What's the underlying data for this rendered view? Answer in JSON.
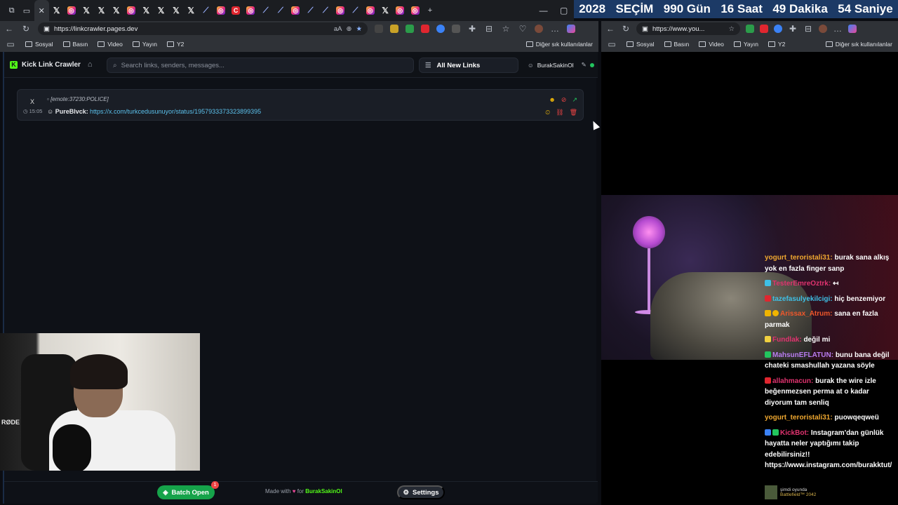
{
  "countdown": {
    "year": "2028",
    "label": "SEÇİM",
    "days": "990 Gün",
    "hours": "16 Saat",
    "minutes": "49 Dakika",
    "seconds": "54 Saniye"
  },
  "browser_left": {
    "url": "https://linkcrawler.pages.dev",
    "tabs": [
      "x",
      "ig",
      "x",
      "x",
      "x",
      "ig",
      "x",
      "x",
      "x",
      "x",
      "feather",
      "ig",
      "red",
      "ig",
      "feather",
      "feather",
      "ig",
      "feather",
      "feather",
      "ig",
      "feather",
      "ig",
      "x",
      "ig",
      "ig"
    ],
    "bookmarks": [
      "Sosyal",
      "Basın",
      "Video",
      "Yayın",
      "Y2"
    ],
    "other_bookmarks": "Diğer sık kullanılanlar"
  },
  "browser_right": {
    "url": "https://www.you...",
    "bookmarks": [
      "Sosyal",
      "Basın",
      "Video",
      "Yayın",
      "Y2"
    ],
    "other_bookmarks": "Diğer sık kullanılanlar"
  },
  "app": {
    "brand": "Kick Link Crawler",
    "search_placeholder": "Search links, senders, messages...",
    "filter_label": "All New Links",
    "username": "BurakSakinOl",
    "message": {
      "platform_icon": "X",
      "time": "15:05",
      "emote": "[emote:37230:POLICE]",
      "sender": "PureBlvck:",
      "link": "https://x.com/turkcedusunuyor/status/1957933373323899395"
    },
    "footer": {
      "batch_label": "Batch Open",
      "batch_count": "1",
      "made_with": "Made with",
      "for": "for",
      "author": "BurakSakinOl",
      "settings_label": "Settings"
    }
  },
  "webcam": {
    "mic_brand": "RØDE"
  },
  "chat": [
    {
      "user": "yogurt_teroristali31:",
      "color": "#f0a830",
      "text": "burak sana alkış yok en fazla finger sanp"
    },
    {
      "user": "TesterEmreOztrk:",
      "color": "#e0336f",
      "text": "↤"
    },
    {
      "user": "tazefasulyekilcigi:",
      "color": "#3ec0e6",
      "text": "hiç benzemiyor"
    },
    {
      "user": "Arissax_Atrum:",
      "color": "#f0572a",
      "text": "sana en fazla parmak"
    },
    {
      "user": "Fundlak:",
      "color": "#e0336f",
      "text": "değil mi"
    },
    {
      "user": "MahsunEFLATUN:",
      "color": "#b87cf0",
      "text": "bunu bana değil chateki smashullah yazana söyle"
    },
    {
      "user": "allahmacun:",
      "color": "#e0336f",
      "text": "burak the wire izle beğenmezsen perma at o kadar diyorum tam senliq"
    },
    {
      "user": "yogurt_teroristali31:",
      "color": "#f0a830",
      "text": "puowqeqweü"
    },
    {
      "user": "KickBot:",
      "color": "#e0336f",
      "text": "Instagram'dan günlük hayatta neler yaptığımı takip edebilirsiniz!! https://www.instagram.com/burakktut/"
    }
  ],
  "now_playing": {
    "label": "şimdi oyunda",
    "game": "Battlefield™ 2042"
  },
  "colors": {
    "kick_green": "#53fc18",
    "batch_green": "#16a34a",
    "link_blue": "#5bc0eb",
    "countdown_bg": "#1c3a66"
  }
}
